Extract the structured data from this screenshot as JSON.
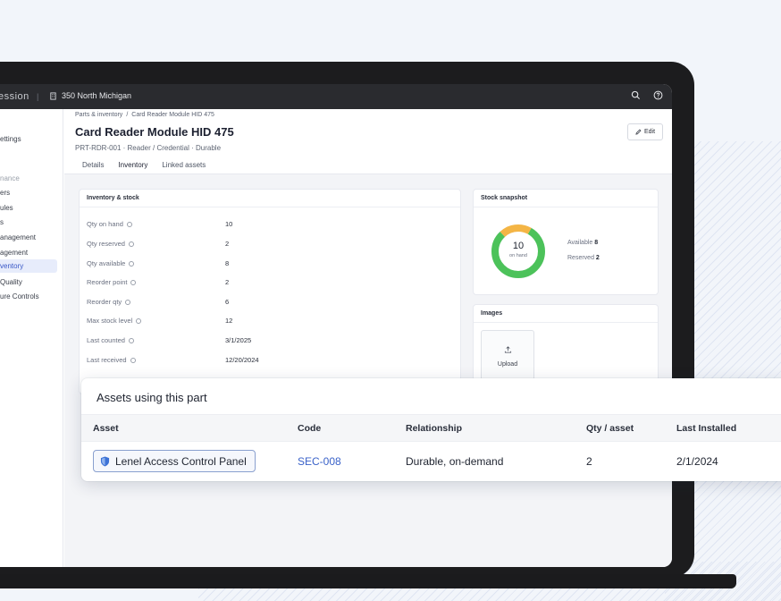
{
  "app": {
    "brand": "ession",
    "building": "350 North Michigan"
  },
  "sidebar": {
    "items": [
      {
        "label": "ettings",
        "state": "normal"
      },
      {
        "label": "nance",
        "state": "muted"
      },
      {
        "label": "ers",
        "state": "normal"
      },
      {
        "label": "ules",
        "state": "normal"
      },
      {
        "label": "s",
        "state": "normal"
      },
      {
        "label": "anagement",
        "state": "normal"
      },
      {
        "label": "agement",
        "state": "normal"
      },
      {
        "label": "ventory",
        "state": "active"
      },
      {
        "label": "Quality",
        "state": "normal"
      },
      {
        "label": "ure Controls",
        "state": "normal"
      }
    ]
  },
  "breadcrumb": {
    "parent": "Parts & inventory",
    "separator": "/",
    "current": "Card Reader Module HID 475"
  },
  "header": {
    "title": "Card Reader Module HID 475",
    "subtitle": "PRT-RDR-001 · Reader / Credential · Durable",
    "edit_label": "Edit"
  },
  "tabs": [
    {
      "label": "Details",
      "active": false
    },
    {
      "label": "Inventory",
      "active": true
    },
    {
      "label": "Linked assets",
      "active": false
    }
  ],
  "inventory": {
    "title": "Inventory & stock",
    "rows": [
      {
        "label": "Qty on hand",
        "value": "10"
      },
      {
        "label": "Qty reserved",
        "value": "2"
      },
      {
        "label": "Qty available",
        "value": "8"
      },
      {
        "label": "Reorder point",
        "value": "2"
      },
      {
        "label": "Reorder qty",
        "value": "6"
      },
      {
        "label": "Max stock level",
        "value": "12"
      },
      {
        "label": "Last counted",
        "value": "3/1/2025"
      },
      {
        "label": "Last received",
        "value": "12/20/2024"
      }
    ]
  },
  "snapshot": {
    "title": "Stock snapshot",
    "center_value": "10",
    "center_label": "on hand",
    "available_label": "Available",
    "available_value": "8",
    "reserved_label": "Reserved",
    "reserved_value": "2",
    "available_fraction": 0.8,
    "reserved_fraction": 0.2,
    "colors": {
      "available": "#4cc25a",
      "reserved": "#f4b545"
    }
  },
  "images": {
    "title": "Images",
    "upload_label": "Upload"
  },
  "popup": {
    "title": "Assets using this part",
    "columns": [
      "Asset",
      "Code",
      "Relationship",
      "Qty / asset",
      "Last Installed"
    ],
    "row": {
      "asset": "Lenel Access Control Panel",
      "code": "SEC-008",
      "relationship": "Durable, on-demand",
      "qty": "2",
      "last_installed": "2/1/2024"
    }
  },
  "colors": {
    "accent": "#3a5bd0",
    "link": "#3a62c9",
    "topbar": "#2a2b2f"
  }
}
